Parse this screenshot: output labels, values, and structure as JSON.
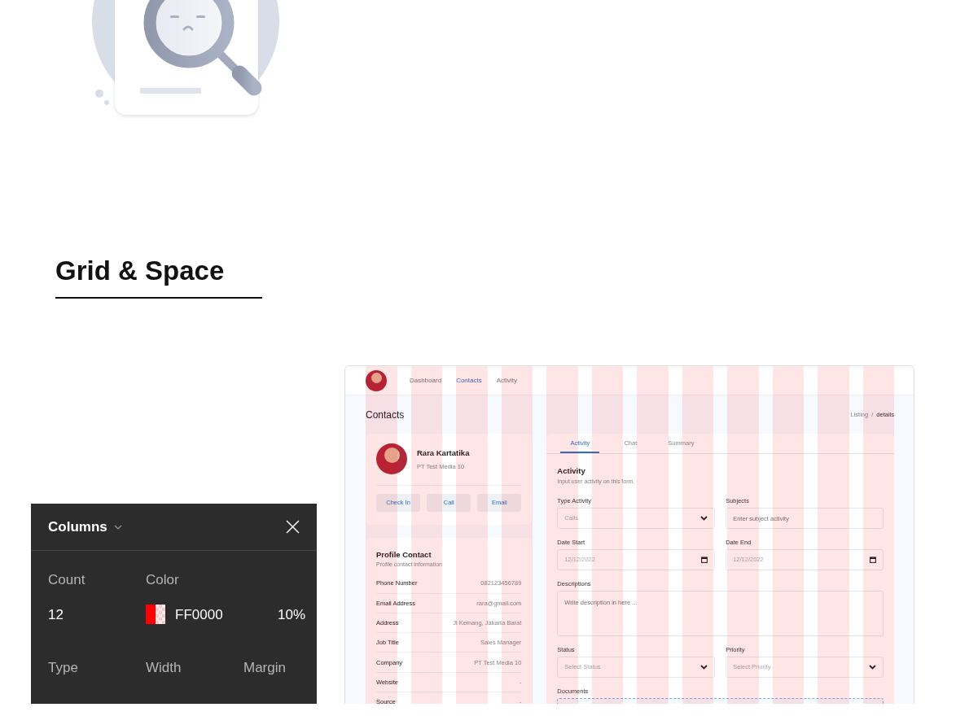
{
  "heading": "Grid & Space",
  "mockup": {
    "nav": [
      {
        "label": "Dashboard",
        "selected": false
      },
      {
        "label": "Contacts",
        "selected": true
      },
      {
        "label": "Activity",
        "selected": false
      }
    ],
    "page_title": "Contacts",
    "breadcrumb": {
      "items": [
        "Listing",
        "details"
      ],
      "separator": "/"
    },
    "profile": {
      "name": "Rara Kartatika",
      "company": "PT Test Media 10",
      "actions": [
        "Check In",
        "Call",
        "Email"
      ]
    },
    "profile_contact": {
      "title": "Profile Contact",
      "subtitle": "Profile contact information",
      "rows": [
        {
          "label": "Phone Number",
          "value": "082123456789"
        },
        {
          "label": "Email Address",
          "value": "rara@gmail.com"
        },
        {
          "label": "Address",
          "value": "Jl Kemang, Jakarta Barat"
        },
        {
          "label": "Job Title",
          "value": "Sales Manager"
        },
        {
          "label": "Company",
          "value": "PT Test Media 10"
        },
        {
          "label": "Website",
          "value": "-"
        },
        {
          "label": "Source",
          "value": "-"
        }
      ]
    },
    "tabs": [
      {
        "label": "Activity",
        "selected": true
      },
      {
        "label": "Chat",
        "selected": false
      },
      {
        "label": "Summary",
        "selected": false
      }
    ],
    "form": {
      "title": "Activity",
      "subtitle": "Input user activity on this form.",
      "fields": [
        {
          "label": "Type Activity",
          "kind": "select",
          "value": "Calls"
        },
        {
          "label": "Subjects",
          "kind": "text",
          "placeholder": "Enter subject activity"
        },
        {
          "label": "Date Start",
          "kind": "date",
          "value": "12/12/2022"
        },
        {
          "label": "Date End",
          "kind": "date",
          "value": "12/12/2022"
        },
        {
          "label": "Descriptions",
          "kind": "textarea",
          "placeholder": "Write description in here ..."
        },
        {
          "label": "Status",
          "kind": "select",
          "placeholder": "Select Status"
        },
        {
          "label": "Priority",
          "kind": "select",
          "placeholder": "Select Priority"
        },
        {
          "label": "Documents",
          "kind": "dropzone"
        }
      ]
    }
  },
  "columns_panel": {
    "title": "Columns",
    "count_label": "Count",
    "count": "12",
    "color_label": "Color",
    "color": "#ff0000",
    "color_hex": "FF0000",
    "opacity": "10%",
    "type_label": "Type",
    "width_label": "Width",
    "margin_label": "Margin"
  }
}
